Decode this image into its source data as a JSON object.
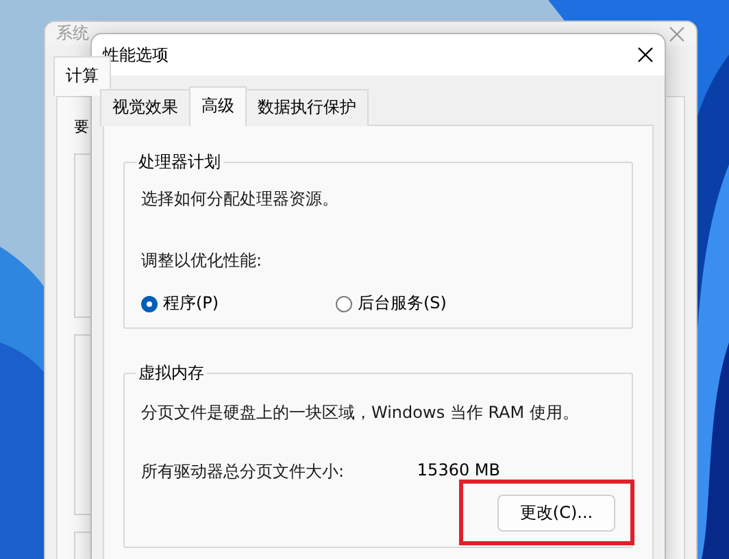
{
  "background_window": {
    "title": "系统",
    "tabs": [
      {
        "label": "计算",
        "selected": true
      }
    ],
    "heading": "要"
  },
  "dialog": {
    "title": "性能选项",
    "tabs": [
      {
        "label": "视觉效果",
        "selected": false
      },
      {
        "label": "高级",
        "selected": true
      },
      {
        "label": "数据执行保护",
        "selected": false
      }
    ],
    "processor_group": {
      "title": "处理器计划",
      "description": "选择如何分配处理器资源。",
      "prompt": "调整以优化性能:",
      "options": [
        {
          "label": "程序(P)",
          "selected": true
        },
        {
          "label": "后台服务(S)",
          "selected": false
        }
      ]
    },
    "memory_group": {
      "title": "虚拟内存",
      "description": "分页文件是硬盘上的一块区域，Windows 当作 RAM 使用。",
      "total_label": "所有驱动器总分页文件大小:",
      "total_value": "15360 MB",
      "change_button": {
        "label": "更改(C)...",
        "highlighted": true
      }
    }
  }
}
